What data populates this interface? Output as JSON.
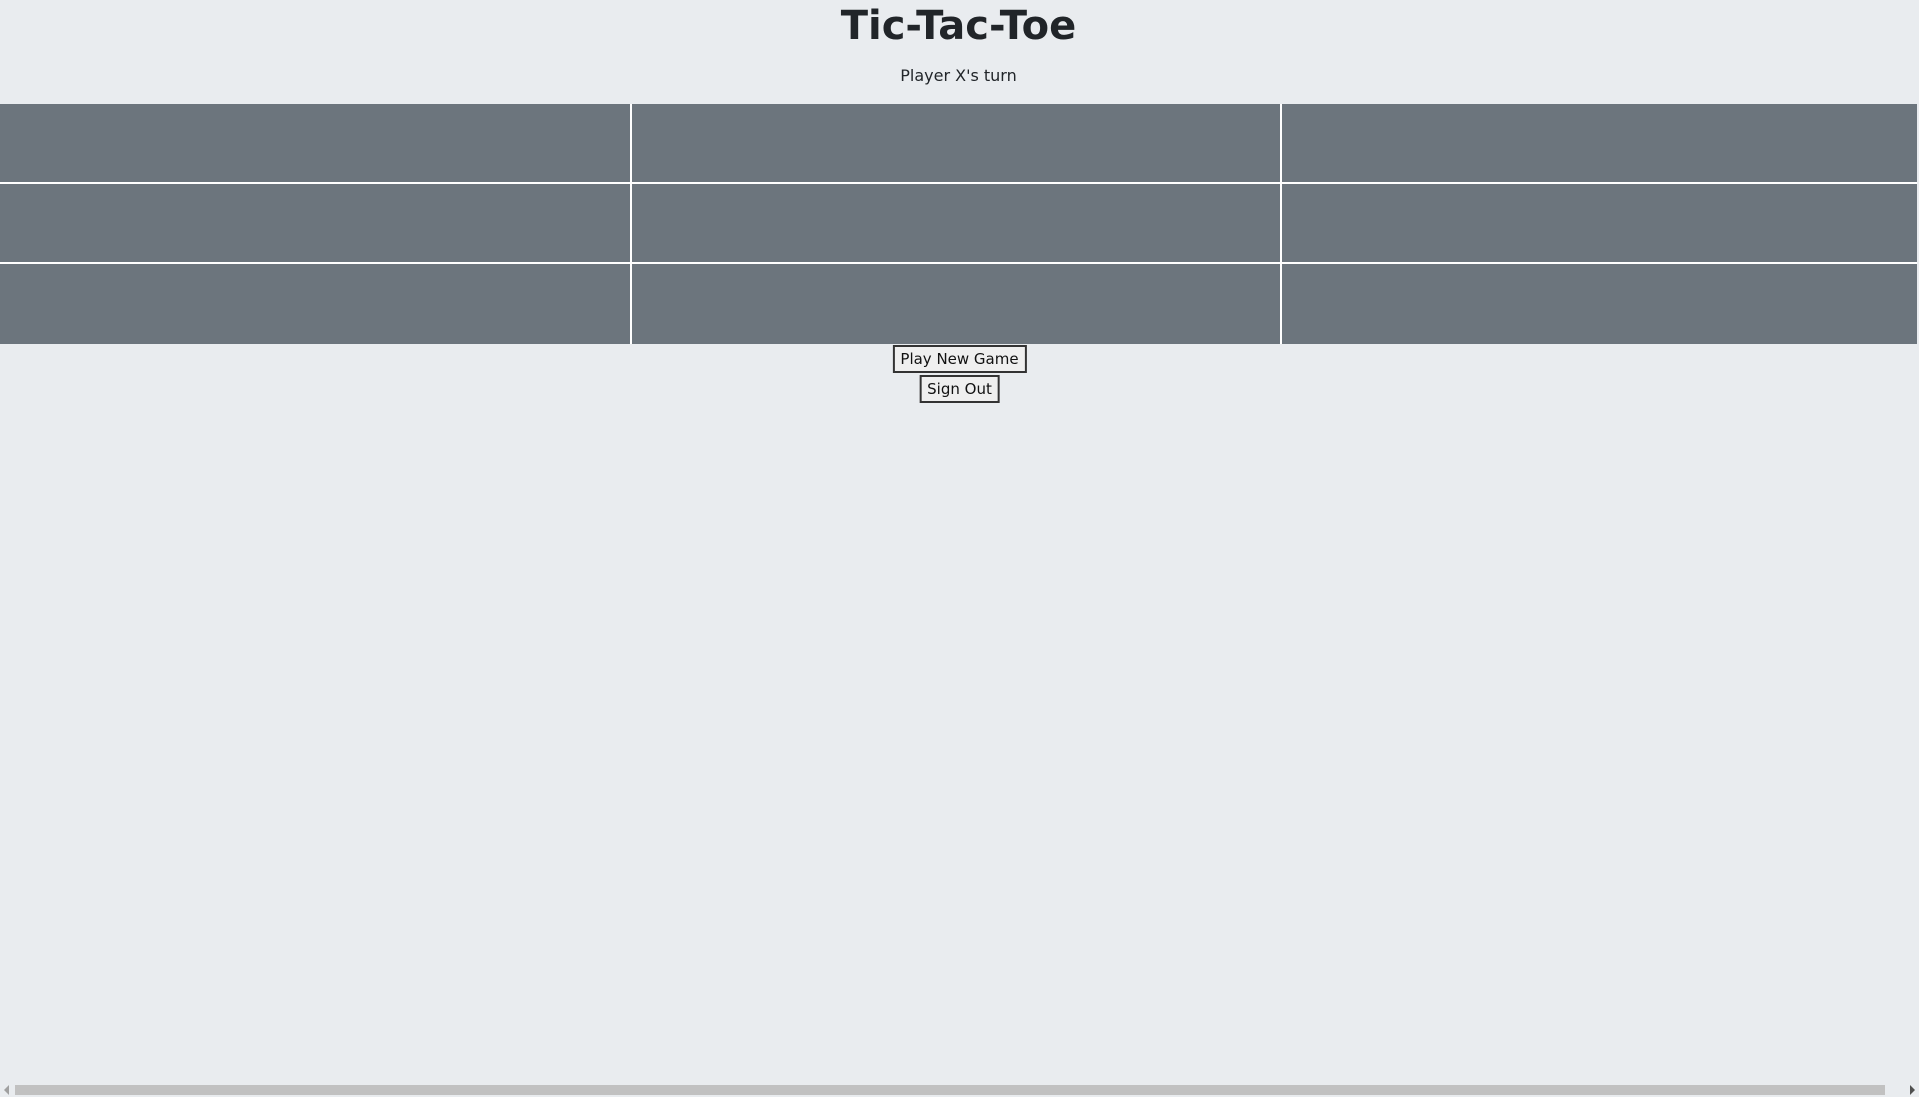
{
  "header": {
    "title": "Tic-Tac-Toe",
    "status": "Player X's turn"
  },
  "board": {
    "cells": [
      [
        "",
        "",
        ""
      ],
      [
        "",
        "",
        ""
      ],
      [
        "",
        "",
        ""
      ]
    ]
  },
  "actions": {
    "new_game_label": "Play New Game",
    "sign_out_label": "Sign Out"
  },
  "colors": {
    "background": "#e9ecef",
    "cell": "#6c757d",
    "grid_line": "#ffffff"
  }
}
